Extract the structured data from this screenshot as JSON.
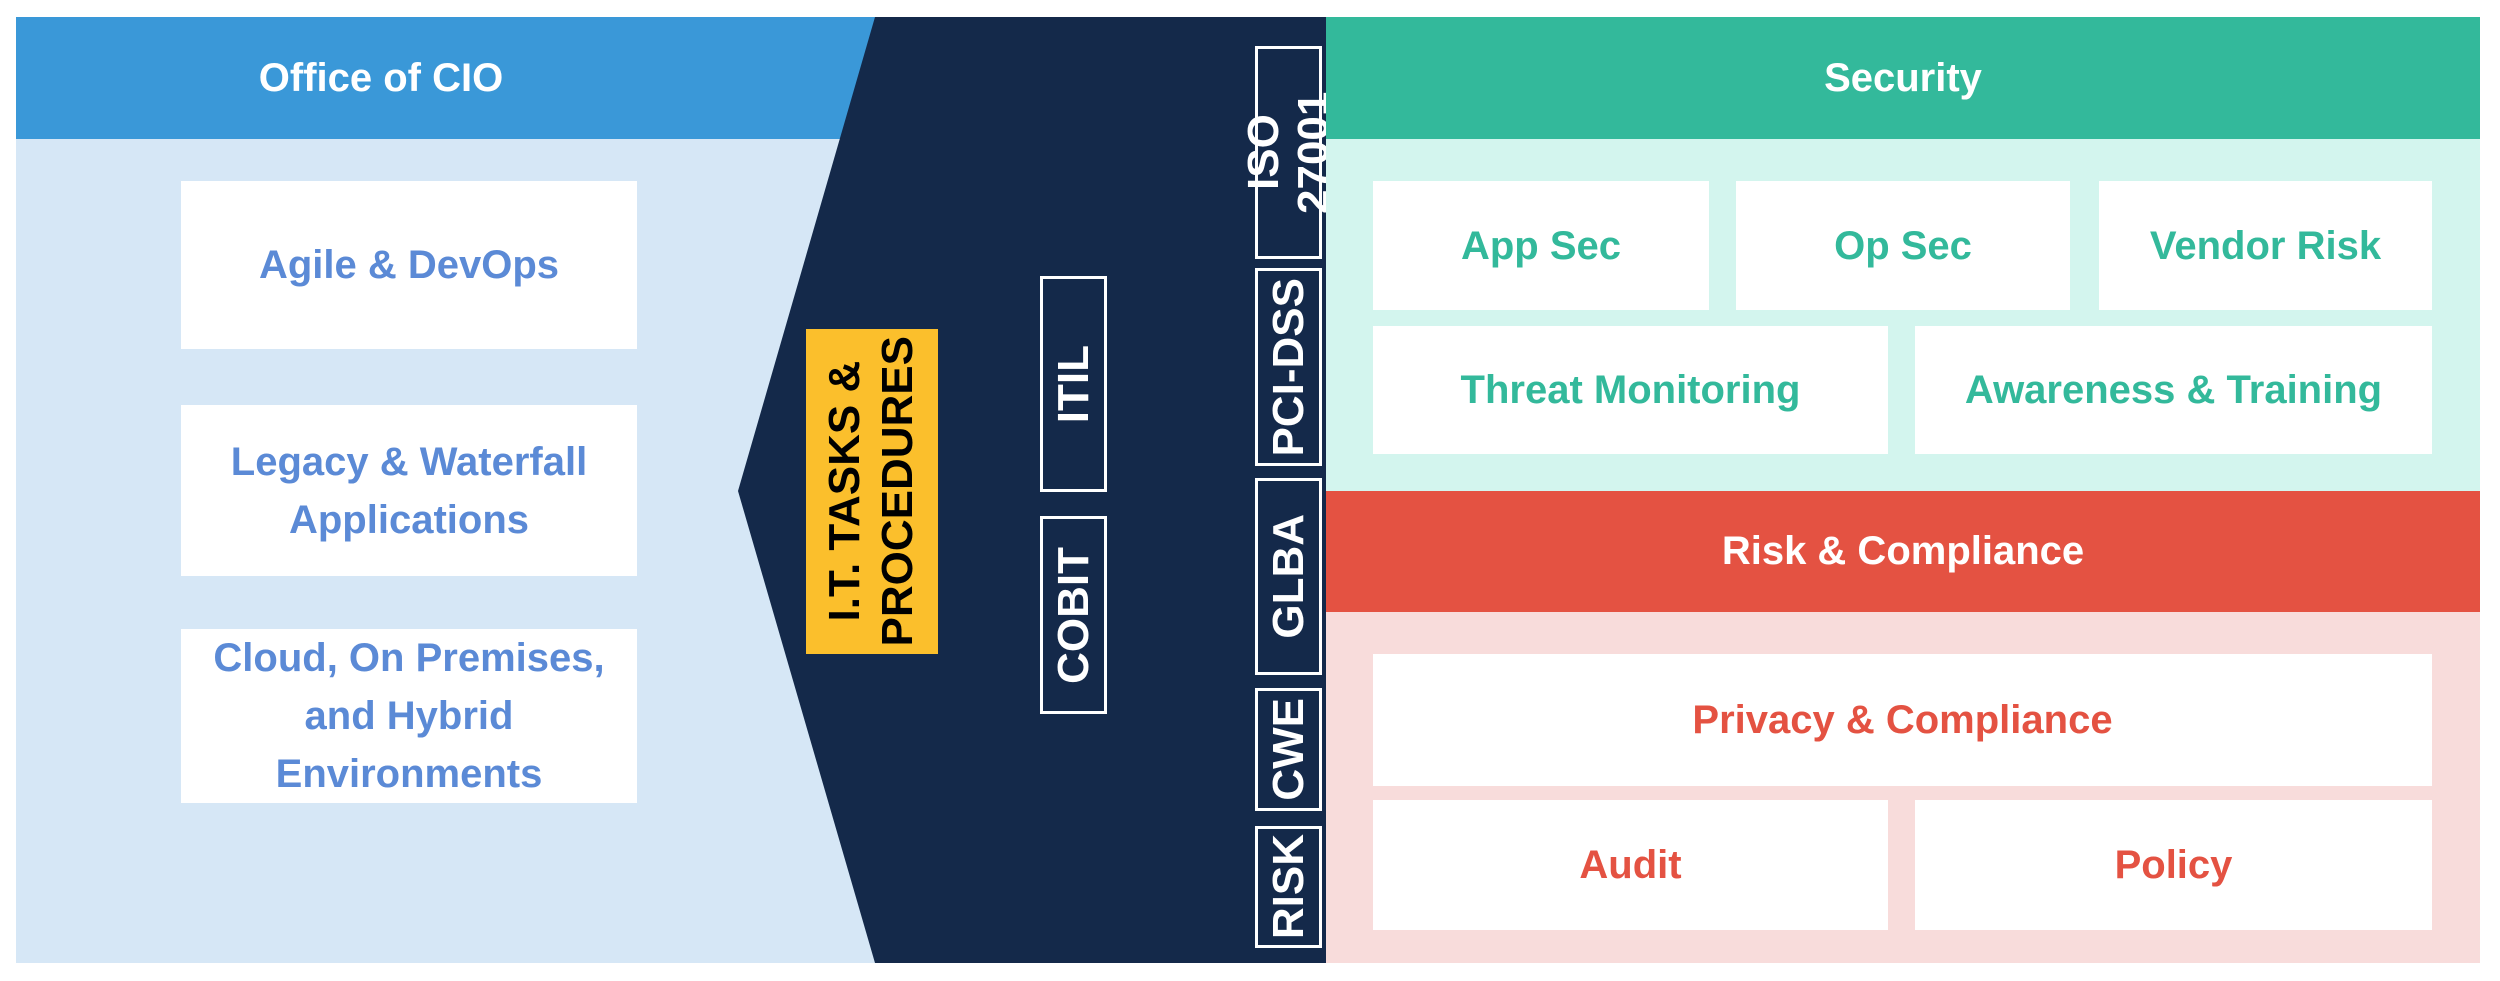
{
  "left": {
    "header": "Office of CIO",
    "items": [
      "Agile & DevOps",
      "Legacy & Waterfall Applications",
      "Cloud, On Premises, and Hybrid Environments"
    ]
  },
  "center": {
    "tasks_label_line1": "I.T. TASKS &",
    "tasks_label_line2": "PROCEDURES",
    "frameworks": [
      "ITIL",
      "COBIT"
    ],
    "standards": [
      "ISO 27001",
      "PCI-DSS",
      "GLBA",
      "CWE",
      "RISK"
    ]
  },
  "security": {
    "header": "Security",
    "items": [
      "App Sec",
      "Op Sec",
      "Vendor Risk",
      "Threat Monitoring",
      "Awareness & Training"
    ]
  },
  "risk": {
    "header": "Risk & Compliance",
    "items": [
      "Privacy & Compliance",
      "Audit",
      "Policy"
    ]
  },
  "colors": {
    "cio_blue": "#3a98d8",
    "cio_bg": "#d6e7f6",
    "navy": "#14294a",
    "security_green": "#33b99b",
    "security_bg": "#d3f5ee",
    "risk_red": "#e45242",
    "risk_bg": "#f8dcdb",
    "tasks_yellow": "#fbbf2c"
  }
}
